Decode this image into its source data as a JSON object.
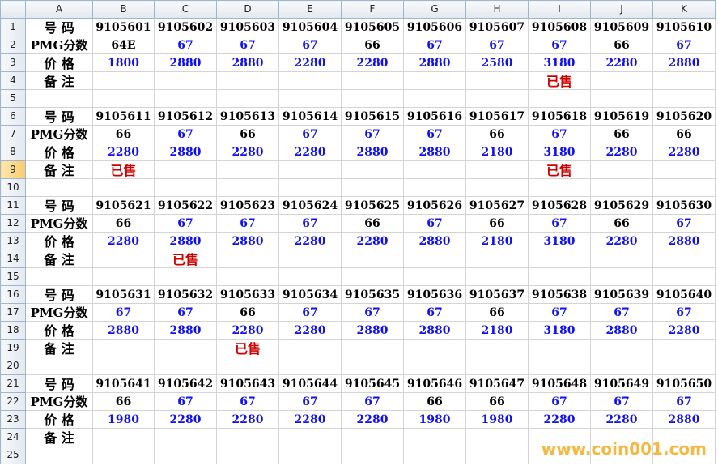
{
  "sheet": {
    "columns": [
      "A",
      "B",
      "C",
      "D",
      "E",
      "F",
      "G",
      "H",
      "I",
      "J",
      "K"
    ],
    "rows": [
      {
        "n": "1",
        "type": "num",
        "label": "号  码",
        "cells": [
          "9105601",
          "9105602",
          "9105603",
          "9105604",
          "9105605",
          "9105606",
          "9105607",
          "9105608",
          "9105609",
          "9105610"
        ]
      },
      {
        "n": "2",
        "type": "pmg",
        "label": "PMG分数",
        "cells": [
          "64E",
          "67",
          "67",
          "67",
          "66",
          "67",
          "67",
          "67",
          "66",
          "67"
        ]
      },
      {
        "n": "3",
        "type": "price",
        "label": "价  格",
        "cells": [
          "1800",
          "2880",
          "2880",
          "2280",
          "2280",
          "2880",
          "2580",
          "3180",
          "2280",
          "2880"
        ]
      },
      {
        "n": "4",
        "type": "note",
        "label": "备  注",
        "cells": [
          "",
          "",
          "",
          "",
          "",
          "",
          "",
          "已售",
          "",
          ""
        ]
      },
      {
        "n": "5",
        "type": "blank",
        "label": "",
        "cells": [
          "",
          "",
          "",
          "",
          "",
          "",
          "",
          "",
          "",
          ""
        ]
      },
      {
        "n": "6",
        "type": "num",
        "label": "号  码",
        "cells": [
          "9105611",
          "9105612",
          "9105613",
          "9105614",
          "9105615",
          "9105616",
          "9105617",
          "9105618",
          "9105619",
          "9105620"
        ]
      },
      {
        "n": "7",
        "type": "pmg",
        "label": "PMG分数",
        "cells": [
          "66",
          "67",
          "66",
          "67",
          "67",
          "67",
          "66",
          "67",
          "66",
          "66"
        ]
      },
      {
        "n": "8",
        "type": "price",
        "label": "价  格",
        "cells": [
          "2280",
          "2880",
          "2280",
          "2280",
          "2880",
          "2880",
          "2180",
          "3180",
          "2280",
          "2280"
        ]
      },
      {
        "n": "9",
        "type": "note",
        "label": "备  注",
        "cells": [
          "已售",
          "",
          "",
          "",
          "",
          "",
          "",
          "已售",
          "",
          ""
        ]
      },
      {
        "n": "10",
        "type": "blank",
        "label": "",
        "cells": [
          "",
          "",
          "",
          "",
          "",
          "",
          "",
          "",
          "",
          ""
        ]
      },
      {
        "n": "11",
        "type": "num",
        "label": "号  码",
        "cells": [
          "9105621",
          "9105622",
          "9105623",
          "9105624",
          "9105625",
          "9105626",
          "9105627",
          "9105628",
          "9105629",
          "9105630"
        ]
      },
      {
        "n": "12",
        "type": "pmg",
        "label": "PMG分数",
        "cells": [
          "66",
          "67",
          "67",
          "67",
          "66",
          "67",
          "66",
          "67",
          "66",
          "67"
        ]
      },
      {
        "n": "13",
        "type": "price",
        "label": "价  格",
        "cells": [
          "2280",
          "2880",
          "2880",
          "2280",
          "2280",
          "2880",
          "2180",
          "3180",
          "2280",
          "2880"
        ]
      },
      {
        "n": "14",
        "type": "note",
        "label": "备  注",
        "cells": [
          "",
          "已售",
          "",
          "",
          "",
          "",
          "",
          "",
          "",
          ""
        ]
      },
      {
        "n": "15",
        "type": "blank",
        "label": "",
        "cells": [
          "",
          "",
          "",
          "",
          "",
          "",
          "",
          "",
          "",
          ""
        ]
      },
      {
        "n": "16",
        "type": "num",
        "label": "号  码",
        "cells": [
          "9105631",
          "9105632",
          "9105633",
          "9105634",
          "9105635",
          "9105636",
          "9105637",
          "9105638",
          "9105639",
          "9105640"
        ]
      },
      {
        "n": "17",
        "type": "pmg",
        "label": "PMG分数",
        "cells": [
          "67",
          "67",
          "66",
          "67",
          "67",
          "67",
          "66",
          "67",
          "67",
          "67"
        ]
      },
      {
        "n": "18",
        "type": "price",
        "label": "价  格",
        "cells": [
          "2880",
          "2880",
          "2280",
          "2280",
          "2880",
          "2880",
          "2180",
          "3180",
          "2880",
          "2280"
        ]
      },
      {
        "n": "19",
        "type": "note",
        "label": "备  注",
        "cells": [
          "",
          "",
          "已售",
          "",
          "",
          "",
          "",
          "",
          "",
          ""
        ]
      },
      {
        "n": "20",
        "type": "blank",
        "label": "",
        "cells": [
          "",
          "",
          "",
          "",
          "",
          "",
          "",
          "",
          "",
          ""
        ]
      },
      {
        "n": "21",
        "type": "num",
        "label": "号  码",
        "cells": [
          "9105641",
          "9105642",
          "9105643",
          "9105644",
          "9105645",
          "9105646",
          "9105647",
          "9105648",
          "9105649",
          "9105650"
        ]
      },
      {
        "n": "22",
        "type": "pmg",
        "label": "PMG分数",
        "cells": [
          "66",
          "67",
          "67",
          "67",
          "67",
          "66",
          "66",
          "67",
          "67",
          "67"
        ]
      },
      {
        "n": "23",
        "type": "price",
        "label": "价  格",
        "cells": [
          "1980",
          "2280",
          "2280",
          "2280",
          "2280",
          "1980",
          "1980",
          "2280",
          "2280",
          "2880"
        ]
      },
      {
        "n": "24",
        "type": "note",
        "label": "备  注",
        "cells": [
          "",
          "",
          "",
          "",
          "",
          "",
          "",
          "",
          "",
          ""
        ]
      },
      {
        "n": "25",
        "type": "blank",
        "label": "",
        "cells": [
          "",
          "",
          "",
          "",
          "",
          "",
          "",
          "",
          "",
          ""
        ]
      }
    ],
    "selected_row": "9",
    "colors": {
      "blue": "#1010f0",
      "red": "#d00000",
      "black": "#000000"
    }
  },
  "watermark": "www.coin001.com"
}
